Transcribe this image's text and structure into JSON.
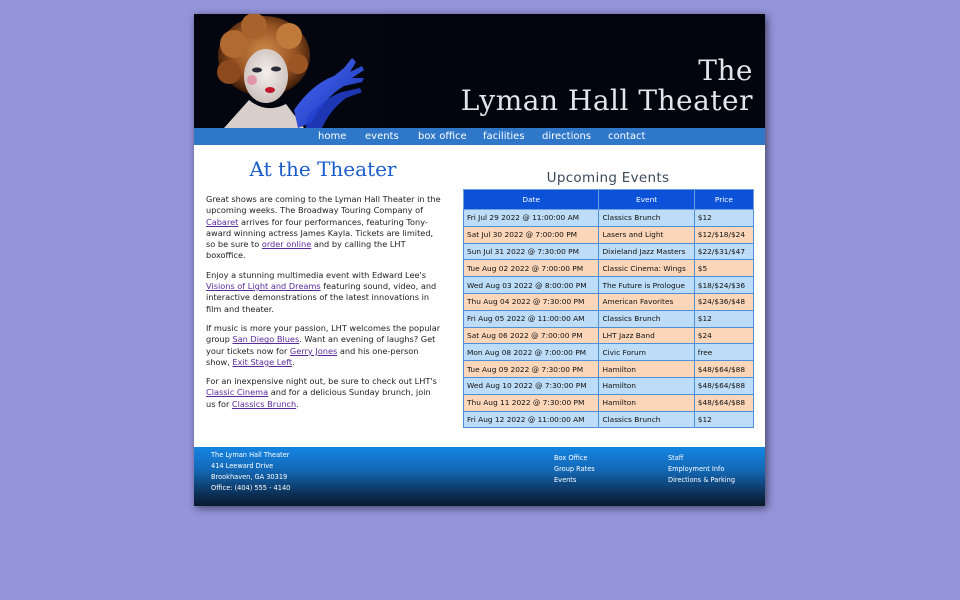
{
  "site": {
    "title_line1": "The",
    "title_line2": "Lyman Hall Theater"
  },
  "nav": {
    "items": [
      "home",
      "events",
      "box office",
      "facilities",
      "directions",
      "contact"
    ]
  },
  "main": {
    "heading": "At the Theater",
    "p1": {
      "t1": "Great shows are coming to the Lyman Hall Theater in the upcoming weeks. The Broadway Touring Company of ",
      "link1": "Cabaret",
      "t2": " arrives for four performances, featuring Tony-award winning actress James Kayla. Tickets are limited, so be sure to ",
      "link2": "order online",
      "t3": " and by calling the LHT boxoffice."
    },
    "p2": {
      "t1": "Enjoy a stunning multimedia event with Edward Lee's ",
      "link1": "Visions of Light and Dreams",
      "t2": " featuring sound, video, and interactive demonstrations of the latest innovations in film and theater."
    },
    "p3": {
      "t1": "If music is more your passion, LHT welcomes the popular group ",
      "link1": "San Diego Blues",
      "t2": ". Want an evening of laughs? Get your tickets now for ",
      "link2": "Gerry Jones",
      "t3": " and his one-person show, ",
      "link3": "Exit Stage Left",
      "t4": "."
    },
    "p4": {
      "t1": "For an inexpensive night out, be sure to check out LHT's ",
      "link1": "Classic Cinema",
      "t2": " and for a delicious Sunday brunch, join us for ",
      "link2": "Classics Brunch",
      "t3": "."
    }
  },
  "events": {
    "heading": "Upcoming Events",
    "headers": [
      "Date",
      "Event",
      "Price"
    ],
    "rows": [
      [
        "Fri Jul 29 2022 @ 11:00:00 AM",
        "Classics Brunch",
        "$12"
      ],
      [
        "Sat Jul 30 2022 @ 7:00:00 PM",
        "Lasers and Light",
        "$12/$18/$24"
      ],
      [
        "Sun Jul 31 2022 @ 7:30:00 PM",
        "Dixieland Jazz Masters",
        "$22/$31/$47"
      ],
      [
        "Tue Aug 02 2022 @ 7:00:00 PM",
        "Classic Cinema: Wings",
        "$5"
      ],
      [
        "Wed Aug 03 2022 @ 8:00:00 PM",
        "The Future is Prologue",
        "$18/$24/$36"
      ],
      [
        "Thu Aug 04 2022 @ 7:30:00 PM",
        "American Favorites",
        "$24/$36/$48"
      ],
      [
        "Fri Aug 05 2022 @ 11:00:00 AM",
        "Classics Brunch",
        "$12"
      ],
      [
        "Sat Aug 06 2022 @ 7:00:00 PM",
        "LHT Jazz Band",
        "$24"
      ],
      [
        "Mon Aug 08 2022 @ 7:00:00 PM",
        "Civic Forum",
        "free"
      ],
      [
        "Tue Aug 09 2022 @ 7:30:00 PM",
        "Hamilton",
        "$48/$64/$88"
      ],
      [
        "Wed Aug 10 2022 @ 7:30:00 PM",
        "Hamilton",
        "$48/$64/$88"
      ],
      [
        "Thu Aug 11 2022 @ 7:30:00 PM",
        "Hamilton",
        "$48/$64/$88"
      ],
      [
        "Fri Aug 12 2022 @ 11:00:00 AM",
        "Classics Brunch",
        "$12"
      ]
    ]
  },
  "footer": {
    "address": [
      "The Lyman Hall Theater",
      "414 Leeward Drive",
      "Brookhaven, GA 30319",
      "Office: (404) 555 - 4140"
    ],
    "links_col1": [
      "Box Office",
      "Group Rates",
      "Events"
    ],
    "links_col2": [
      "Staff",
      "Employment Info",
      "Directions & Parking"
    ]
  },
  "colors": {
    "background": "#9494db",
    "nav": "#2e77c9",
    "heading": "#1b5ccc",
    "table_header": "#0c52d8",
    "row_blue": "#bcdcf7",
    "row_peach": "#fbd6b8",
    "link": "#5a2a9a"
  }
}
